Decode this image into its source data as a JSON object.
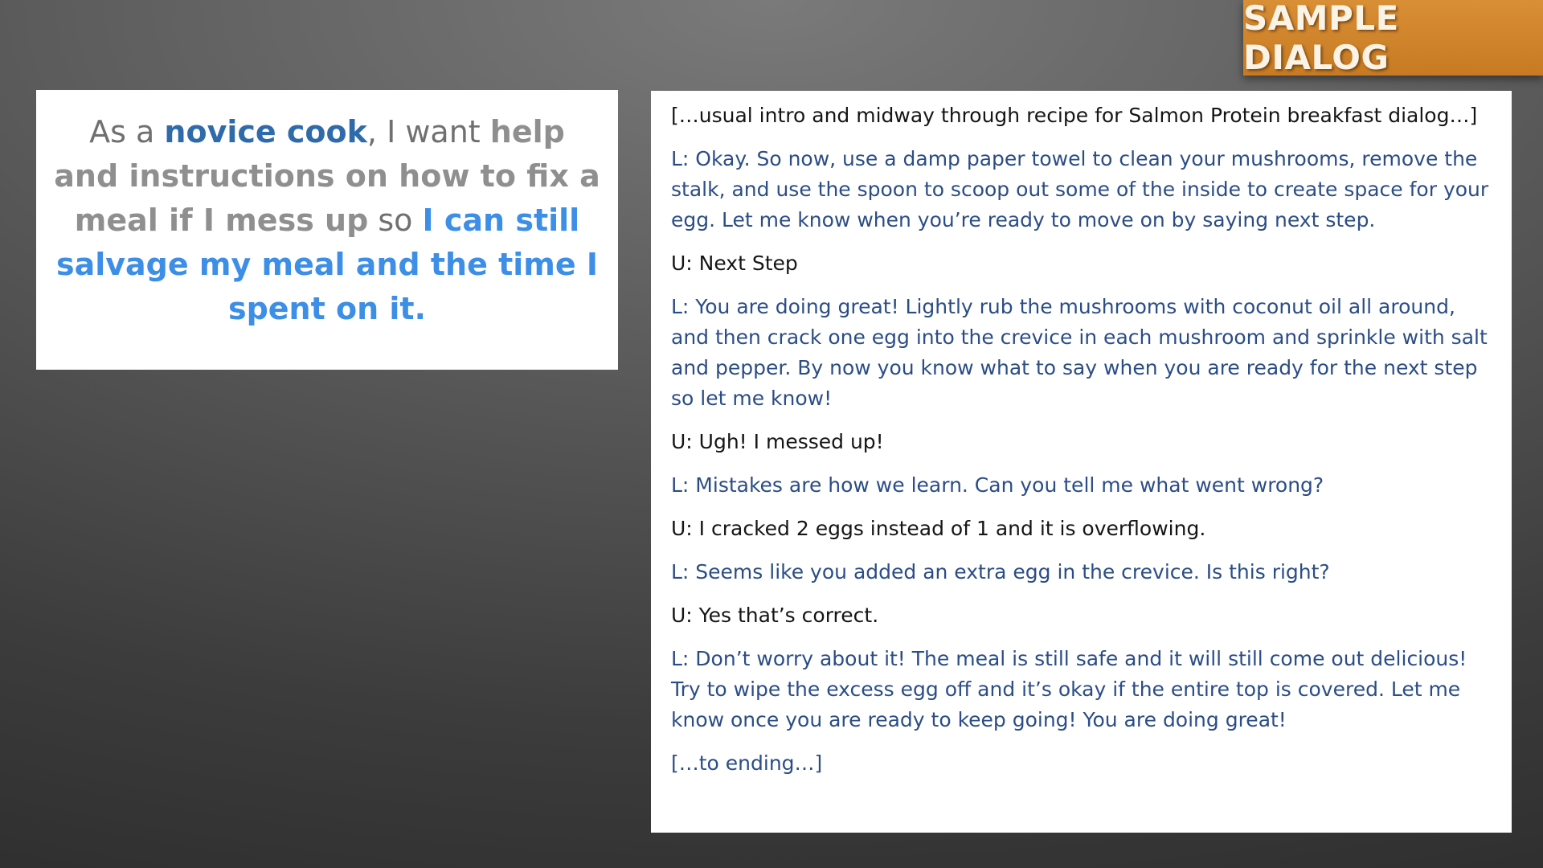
{
  "title": "SAMPLE DIALOG",
  "story": {
    "p1": "As a ",
    "role": "novice cook",
    "p2": ", I want ",
    "want": "help and instructions on how to fix a meal if I mess up",
    "p3": " so ",
    "benefit": "I can still salvage my meal and the time I spent on it."
  },
  "dialog": [
    {
      "speaker": "narration",
      "text": "[…usual intro and midway through recipe for Salmon Protein breakfast dialog…]"
    },
    {
      "speaker": "L",
      "text": "L: Okay.  So now, use a damp paper towel to clean your mushrooms, remove the stalk, and use the spoon to scoop out some of the inside to create space for your egg. Let me know when you’re ready to move on by saying next step."
    },
    {
      "speaker": "U",
      "text": "U: Next Step"
    },
    {
      "speaker": "L",
      "text": "L: You are doing great! Lightly rub the mushrooms with coconut oil all around, and then crack one egg into the crevice in each mushroom and sprinkle with salt and pepper. By now you know what to say when you are ready for the next step so let me know!"
    },
    {
      "speaker": "U",
      "text": "U: Ugh! I messed up!"
    },
    {
      "speaker": "L",
      "text": "L: Mistakes are how we learn. Can you tell me what went wrong?"
    },
    {
      "speaker": "U",
      "text": "U: I cracked 2 eggs instead of 1 and it is overflowing."
    },
    {
      "speaker": "L",
      "text": "L: Seems like you added an extra egg in the crevice.  Is this right?"
    },
    {
      "speaker": "U",
      "text": "U: Yes that’s correct."
    },
    {
      "speaker": "L",
      "text": "L: Don’t worry about it! The meal is still safe and it will still come out delicious! Try to wipe the excess egg off and it’s okay if the entire top is covered.  Let me know once you are ready to keep going! You are doing great!"
    },
    {
      "speaker": "narration-end",
      "text": "[…to ending…]"
    }
  ]
}
